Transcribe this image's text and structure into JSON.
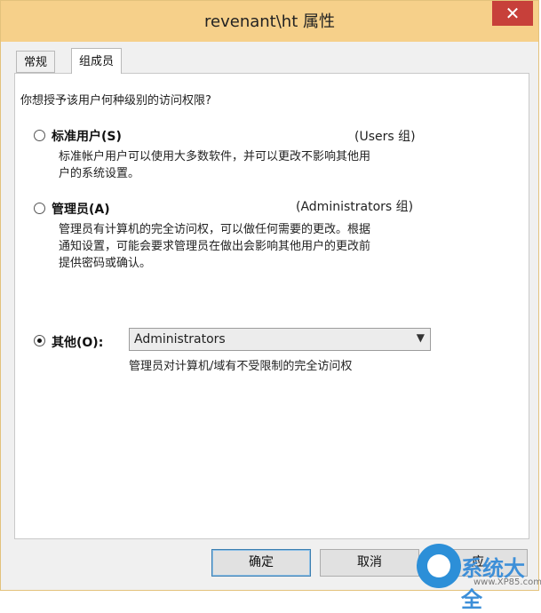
{
  "window": {
    "title": "revenant\\ht 属性",
    "close_glyph": "✕"
  },
  "tabs": [
    {
      "label": "常规",
      "active": false
    },
    {
      "label": "组成员",
      "active": true
    }
  ],
  "content": {
    "question": "你想授予该用户何种级别的访问权限?",
    "options": [
      {
        "label": "标准用户(S)",
        "group": "(Users 组)",
        "selected": false,
        "desc_lines": [
          "标准帐户用户可以使用大多数软件，并可以更改不影响其他用",
          "户的系统设置。"
        ]
      },
      {
        "label": "管理员(A)",
        "group": "(Administrators 组)",
        "selected": false,
        "desc_lines": [
          "管理员有计算机的完全访问权，可以做任何需要的更改。根据",
          "通知设置，可能会要求管理员在做出会影响其他用户的更改前",
          "提供密码或确认。"
        ]
      },
      {
        "label": "其他(O):",
        "selected": true,
        "select_value": "Administrators",
        "desc": "管理员对计算机/域有不受限制的完全访问权"
      }
    ]
  },
  "buttons": {
    "ok": "确定",
    "cancel": "取消",
    "apply_partial": "应"
  },
  "watermark": {
    "text": "系统大全",
    "sub": "www.XP85.com"
  },
  "colors": {
    "titlebar": "#f6d08a",
    "close": "#c7403a",
    "accent": "#2c8fd8"
  }
}
